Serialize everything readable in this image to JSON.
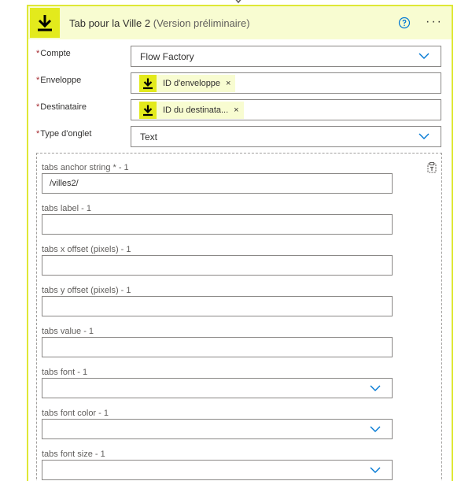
{
  "card": {
    "title": "Tab pour la Ville 2",
    "subtitle": "(Version préliminaire)",
    "accent_color": "#e3ea1c",
    "border_color": "#dfe836",
    "header_bg": "#f8fcd1"
  },
  "fields": {
    "compte": {
      "label": "Compte",
      "value": "Flow Factory"
    },
    "enveloppe": {
      "label": "Enveloppe",
      "token": "ID d'enveloppe"
    },
    "destinataire": {
      "label": "Destinataire",
      "token": "ID du destinata..."
    },
    "type_onglet": {
      "label": "Type d'onglet",
      "value": "Text"
    }
  },
  "tabs": {
    "anchor": {
      "label": "tabs anchor string * - 1",
      "value": "/villes2/"
    },
    "label": {
      "label": "tabs label - 1",
      "value": ""
    },
    "x_offset": {
      "label": "tabs x offset (pixels) - 1",
      "value": ""
    },
    "y_offset": {
      "label": "tabs y offset (pixels) - 1",
      "value": ""
    },
    "value": {
      "label": "tabs value - 1",
      "value": ""
    },
    "font": {
      "label": "tabs font - 1",
      "value": ""
    },
    "font_color": {
      "label": "tabs font color - 1",
      "value": ""
    },
    "font_size": {
      "label": "tabs font size - 1",
      "value": ""
    }
  },
  "icons": {
    "header": "download-arrow-icon",
    "help": "help-circle-icon",
    "more": "more-horizontal-icon",
    "dropdown": "chevron-down-icon",
    "token": "download-arrow-icon",
    "remove": "close-icon",
    "array_mode": "switch-to-text-icon"
  },
  "symbols": {
    "required": "*",
    "remove": "×",
    "more": "···"
  }
}
